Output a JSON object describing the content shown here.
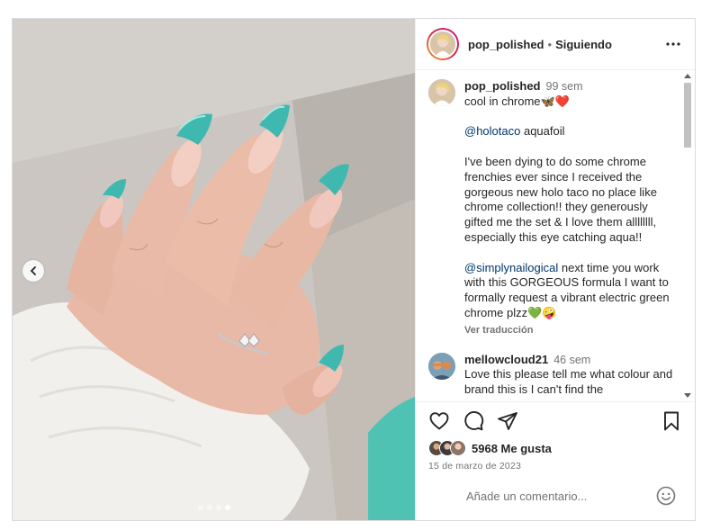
{
  "post": {
    "author": "pop_polished",
    "follow_state": "Siguiendo",
    "separator": "•",
    "carousel": {
      "total": 4,
      "active_index": 3
    }
  },
  "caption": {
    "username": "pop_polished",
    "time": "99 sem",
    "line1": "cool in chrome🦋❤️",
    "mention1": "@holotaco",
    "mention1_rest": " aquafoil",
    "para2": "I've been dying to do some chrome frenchies ever since I received the gorgeous new holo taco no place like chrome collection!! they generously gifted me the set & I love them allllllll, especially this eye catching aqua!!",
    "mention2": "@simplynailogical",
    "para3_rest": " next time you work with this GORGEOUS formula I want to formally request a vibrant electric green chrome plzz💚🤪",
    "translate": "Ver traducción"
  },
  "comments": [
    {
      "username": "mellowcloud21",
      "time": "46 sem",
      "text": "Love this please tell me what colour and brand this is I can't find the"
    }
  ],
  "likes": {
    "count_label": "5968 Me gusta"
  },
  "date": "15 de marzo de 2023",
  "composer": {
    "placeholder": "Añade un comentario..."
  },
  "icons": {
    "prev": "chevron-left-icon",
    "more": "more-options-icon",
    "like": "heart-icon",
    "comment": "comment-icon",
    "share": "send-icon",
    "save": "bookmark-icon",
    "emoji": "emoji-icon"
  }
}
